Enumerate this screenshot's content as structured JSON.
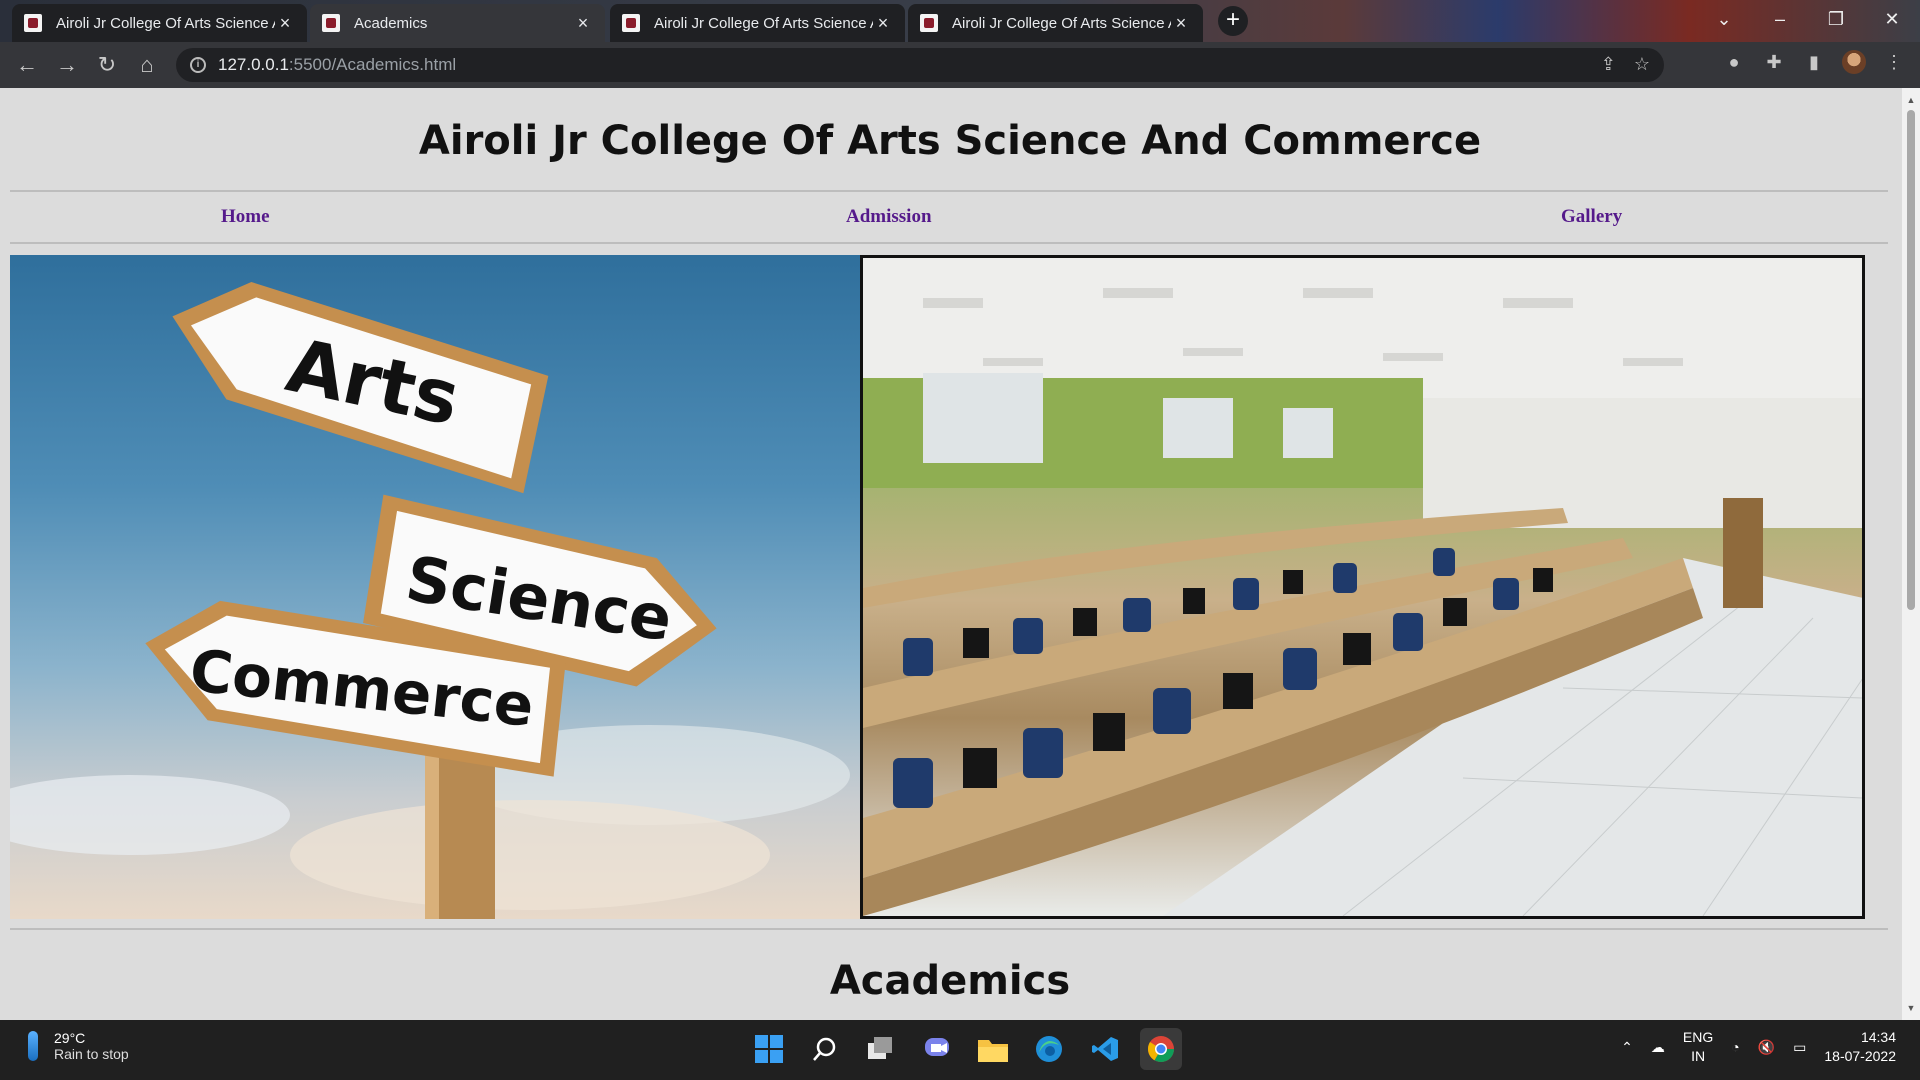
{
  "browser": {
    "tabs": [
      {
        "title": "Airoli Jr College Of Arts Science And Commerce",
        "active": false
      },
      {
        "title": "Academics",
        "active": true
      },
      {
        "title": "Airoli Jr College Of Arts Science And Commerce",
        "active": false
      },
      {
        "title": "Airoli Jr College Of Arts Science And Commerce",
        "active": false
      }
    ],
    "url_host": "127.0.0.1",
    "url_path": ":5500/Academics.html"
  },
  "page": {
    "site_title": "Airoli Jr College Of Arts Science And Commerce",
    "nav": [
      {
        "label": "Home"
      },
      {
        "label": "Admission"
      },
      {
        "label": "Gallery"
      }
    ],
    "signpost_words": [
      "Arts",
      "Science",
      "Commerce"
    ],
    "section_heading": "Academics"
  },
  "taskbar": {
    "weather_temp": "29°C",
    "weather_desc": "Rain to stop",
    "lang_top": "ENG",
    "lang_bottom": "IN",
    "time": "14:34",
    "date": "18-07-2022"
  },
  "colors": {
    "nav_link": "#551a8b",
    "page_bg": "#dcdcdc"
  }
}
